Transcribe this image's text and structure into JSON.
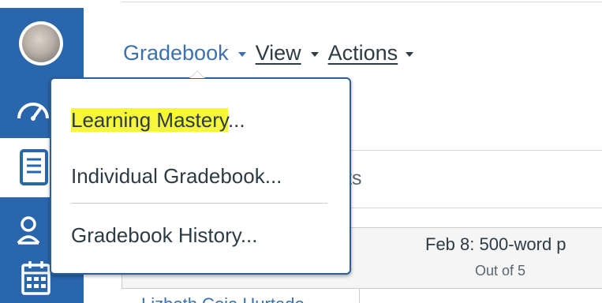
{
  "app": {
    "accent_color": "#2a66ac",
    "text_color": "#2d3b45",
    "link_color": "#3b72ad",
    "highlight_color": "#f7f73a"
  },
  "nav_rail": {
    "items": [
      {
        "icon": "user-avatar"
      },
      {
        "icon": "dashboard-gauge-icon"
      },
      {
        "icon": "courses-book-icon"
      },
      {
        "icon": "groups-people-icon"
      },
      {
        "icon": "calendar-icon"
      }
    ]
  },
  "header": {
    "menus": [
      {
        "label": "Gradebook",
        "icon": "caret-down-icon"
      },
      {
        "label": "View",
        "icon": "caret-down-icon"
      },
      {
        "label": "Actions",
        "icon": "caret-down-icon"
      }
    ]
  },
  "dropdown": {
    "items": [
      {
        "label_highlighted": "Learning Mastery",
        "label_rest": "..."
      },
      {
        "label": "Individual Gradebook..."
      },
      {
        "label": "Gradebook History..."
      }
    ]
  },
  "background": {
    "tabs_fragment": "ts",
    "column": {
      "title": "Feb 8: 500-word p",
      "subtitle": "Out of 5"
    },
    "student": {
      "name": "Lizbeth Coja Hurtado"
    }
  }
}
